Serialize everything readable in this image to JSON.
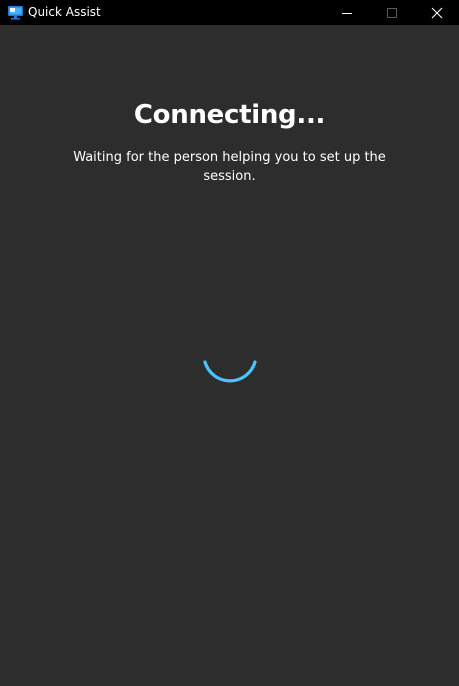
{
  "window": {
    "title": "Quick Assist",
    "icon": "quick-assist-monitor-icon",
    "controls": {
      "minimize_icon": "minimize-icon",
      "maximize_icon": "maximize-icon",
      "close_icon": "close-icon"
    }
  },
  "main": {
    "heading": "Connecting...",
    "message": "Waiting for the person helping you to set up the session.",
    "spinner_icon": "loading-spinner-icon"
  },
  "colors": {
    "titlebar_bg": "#000000",
    "window_bg": "#2d2d2d",
    "text": "#ffffff",
    "accent": "#4cc2ff"
  }
}
